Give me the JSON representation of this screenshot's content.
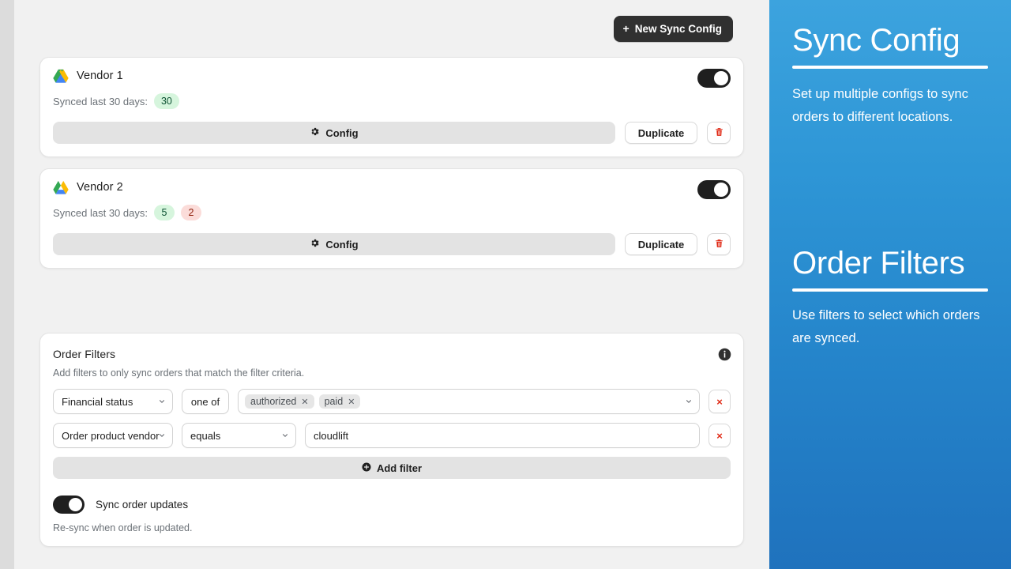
{
  "toolbar": {
    "new_sync_config_label": "New Sync Config",
    "plus_glyph": "+"
  },
  "colors": {
    "primary_button_bg": "#303030",
    "panel_gradient_top": "#3ca3de",
    "panel_gradient_bottom": "#1f72bd",
    "badge_success_bg": "#d6f5dd",
    "badge_success_text": "#0c5132",
    "badge_critical_bg": "#fbdcd9",
    "badge_critical_text": "#8e1f0b",
    "destructive": "#e02a16",
    "page_bg": "#f1f1f1",
    "card_bg": "#ffffff"
  },
  "vendor_cards": [
    {
      "provider_icon": "google-drive-icon",
      "name": "Vendor 1",
      "synced_label": "Synced last 30 days:",
      "badges": [
        {
          "value": "30",
          "tone": "success"
        }
      ],
      "config_label": "Config",
      "config_icon": "gear-icon",
      "duplicate_label": "Duplicate",
      "delete_icon": "trash-icon",
      "enabled": true
    },
    {
      "provider_icon": "google-drive-icon",
      "name": "Vendor 2",
      "synced_label": "Synced last 30 days:",
      "badges": [
        {
          "value": "5",
          "tone": "success"
        },
        {
          "value": "2",
          "tone": "critical"
        }
      ],
      "config_label": "Config",
      "config_icon": "gear-icon",
      "duplicate_label": "Duplicate",
      "delete_icon": "trash-icon",
      "enabled": true
    }
  ],
  "order_filters": {
    "title": "Order Filters",
    "info_icon": "info-circle-icon",
    "help_text": "Add filters to only sync orders that match the filter criteria.",
    "rows": [
      {
        "field": "Financial status",
        "operator": "one of",
        "operator_is_static": true,
        "value_type": "tags",
        "tags": [
          "authorized",
          "paid"
        ],
        "remove_label": "×"
      },
      {
        "field": "Order product vendor",
        "operator": "equals",
        "operator_is_static": false,
        "value_type": "text",
        "value": "cloudlift",
        "placeholder": "",
        "remove_label": "×"
      }
    ],
    "add_filter_label": "Add filter",
    "add_filter_icon": "plus-circle-icon",
    "sync_updates": {
      "label": "Sync order updates",
      "enabled": true,
      "help_text": "Re-sync when order is updated."
    }
  },
  "side_panel": {
    "sections": [
      {
        "heading": "Sync Config",
        "body": "Set up multiple configs to sync orders to different locations."
      },
      {
        "heading": "Order Filters",
        "body": "Use filters to select which orders are synced."
      }
    ]
  }
}
